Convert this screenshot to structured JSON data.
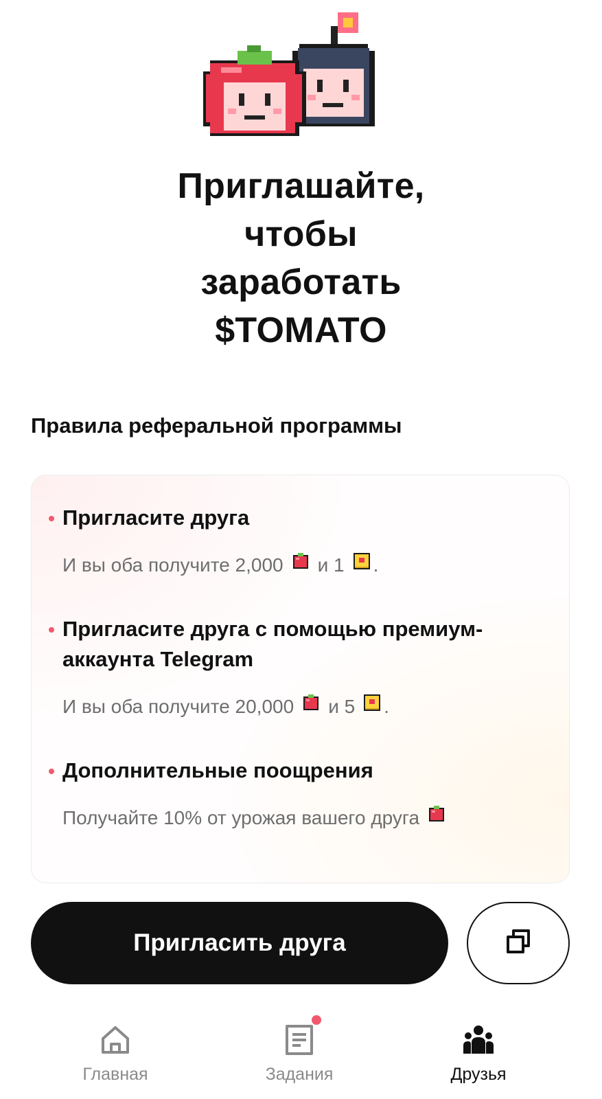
{
  "hero": {
    "title_lines": [
      "Приглашайте,",
      "чтобы",
      "заработать",
      "$TOMATO"
    ]
  },
  "rules": {
    "section_title": "Правила реферальной программы",
    "items": [
      {
        "title": "Пригласите друга",
        "text_prefix": "И вы оба получите 2,000",
        "text_mid": "и 1",
        "text_suffix": ".",
        "icons": [
          "tomato-icon",
          "ticket-icon"
        ]
      },
      {
        "title": "Пригласите друга с помощью премиум-аккаунта Telegram",
        "text_prefix": "И вы оба получите 20,000",
        "text_mid": "и 5",
        "text_suffix": ".",
        "icons": [
          "tomato-icon",
          "ticket-icon"
        ]
      },
      {
        "title": "Дополнительные поощрения",
        "text_prefix": "Получайте 10% от урожая вашего друга",
        "icons": [
          "tomato-icon"
        ]
      }
    ]
  },
  "actions": {
    "invite_label": "Пригласить друга",
    "copy_icon": "copy-icon"
  },
  "tabbar": {
    "tabs": [
      {
        "label": "Главная",
        "icon": "home-icon",
        "active": false
      },
      {
        "label": "Задания",
        "icon": "tasks-icon",
        "active": false,
        "badge": true
      },
      {
        "label": "Друзья",
        "icon": "friends-icon",
        "active": true
      }
    ]
  },
  "colors": {
    "accent": "#f05a6e",
    "primary_button": "#111111",
    "muted_text": "#6e6e6e"
  }
}
